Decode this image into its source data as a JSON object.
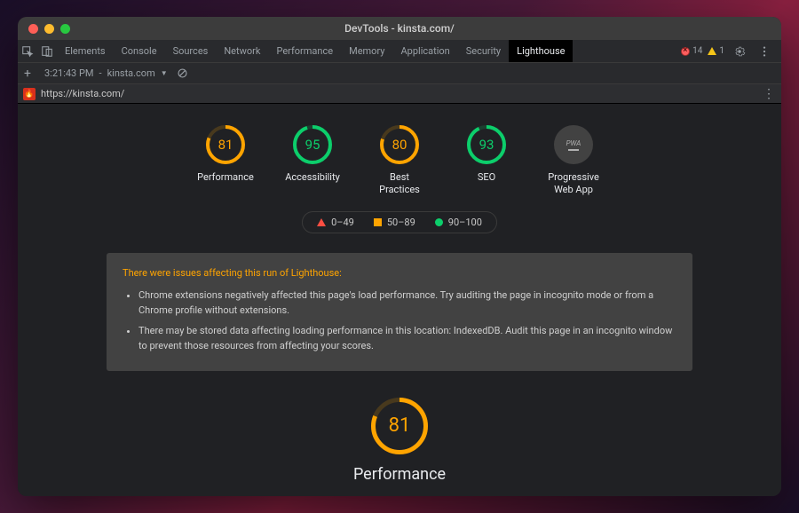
{
  "window_title": "DevTools - kinsta.com/",
  "panels": [
    "Elements",
    "Console",
    "Sources",
    "Network",
    "Performance",
    "Memory",
    "Application",
    "Security",
    "Lighthouse"
  ],
  "active_panel": "Lighthouse",
  "toolbar": {
    "error_count": "14",
    "warn_count": "1"
  },
  "history": {
    "timestamp": "3:21:43 PM",
    "site": "kinsta.com"
  },
  "url": "https://kinsta.com/",
  "gauges": [
    {
      "label": "Performance",
      "value": 81,
      "color": "orange"
    },
    {
      "label": "Accessibility",
      "value": 95,
      "color": "green"
    },
    {
      "label": "Best\nPractices",
      "value": 80,
      "color": "orange"
    },
    {
      "label": "SEO",
      "value": 93,
      "color": "green"
    }
  ],
  "pwa_label": "Progressive\nWeb App",
  "pwa_text": "PWA",
  "legend": [
    {
      "shape": "tri",
      "range": "0–49"
    },
    {
      "shape": "sq",
      "range": "50–89"
    },
    {
      "shape": "ci",
      "range": "90–100"
    }
  ],
  "warning": {
    "title": "There were issues affecting this run of Lighthouse:",
    "items": [
      "Chrome extensions negatively affected this page's load performance. Try auditing the page in incognito mode or from a Chrome profile without extensions.",
      "There may be stored data affecting loading performance in this location: IndexedDB. Audit this page in an incognito window to prevent those resources from affecting your scores."
    ]
  },
  "big": {
    "label": "Performance",
    "value": 81,
    "color": "orange"
  }
}
